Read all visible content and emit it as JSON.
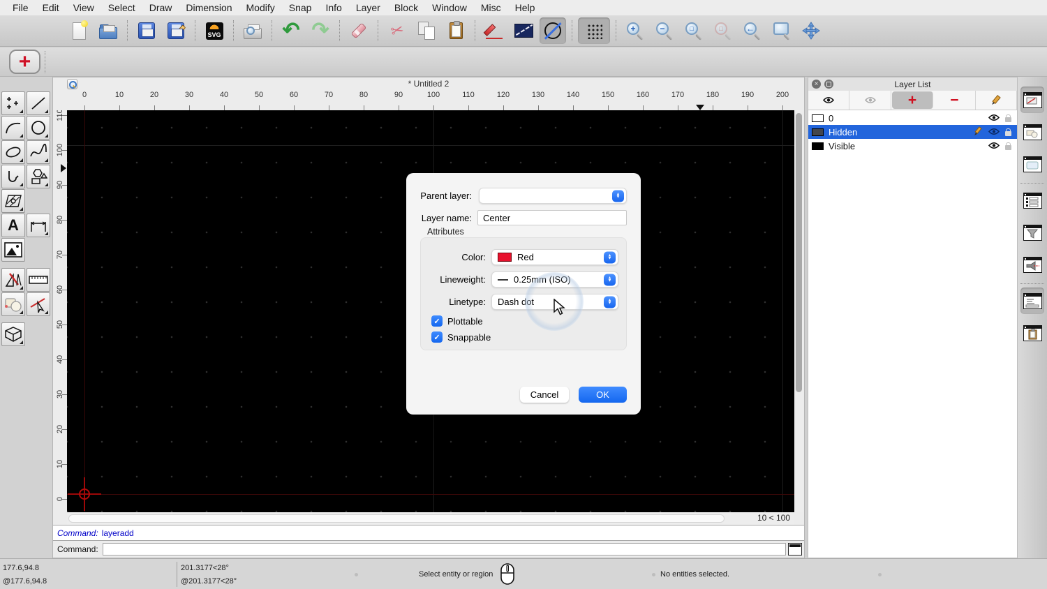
{
  "window": {
    "doc_title": "* Untitled 2"
  },
  "menu": {
    "items": [
      "File",
      "Edit",
      "View",
      "Select",
      "Draw",
      "Dimension",
      "Modify",
      "Snap",
      "Info",
      "Layer",
      "Block",
      "Window",
      "Misc",
      "Help"
    ]
  },
  "icons": {
    "undo-icon": "↶",
    "redo-icon": "↷",
    "cut-icon": "✂",
    "zoom-in-icon": "+",
    "zoom-out-icon": "−",
    "auto-zoom-icon": "□",
    "zoom-selection-icon": "□",
    "previous-view-icon": "←",
    "svg-label": "SVG",
    "text-tool-glyph": "A",
    "add-glyph": "+",
    "remove-glyph": "−",
    "close-glyph": "×",
    "check-glyph": "✓",
    "snap-plus-glyph": "+"
  },
  "rulers": {
    "h_ticks": [
      "0",
      "10",
      "20",
      "30",
      "40",
      "50",
      "60",
      "70",
      "80",
      "90",
      "100",
      "110",
      "120",
      "130",
      "140",
      "150",
      "160",
      "170",
      "180",
      "190",
      "200"
    ],
    "v_ticks": [
      "0",
      "10",
      "20",
      "30",
      "40",
      "50",
      "60",
      "70",
      "80",
      "90",
      "100",
      "110"
    ]
  },
  "canvas": {
    "grid_status": "10 < 100"
  },
  "dialog": {
    "parent_layer_label": "Parent layer:",
    "parent_layer_value": "",
    "layer_name_label": "Layer name:",
    "layer_name_value": "Center",
    "attributes_label": "Attributes",
    "color_label": "Color:",
    "color_value": "Red",
    "lineweight_label": "Lineweight:",
    "lineweight_value": "0.25mm (ISO)",
    "linetype_label": "Linetype:",
    "linetype_value": "Dash dot",
    "plottable_label": "Plottable",
    "snappable_label": "Snappable",
    "cancel_label": "Cancel",
    "ok_label": "OK"
  },
  "layer_list": {
    "title": "Layer List",
    "layers": [
      {
        "name": "0",
        "swatch": "#FFFFFF",
        "selected": false,
        "editing": false
      },
      {
        "name": "Hidden",
        "swatch": "#43464D",
        "selected": true,
        "editing": true
      },
      {
        "name": "Visible",
        "swatch": "#000000",
        "selected": false,
        "editing": false
      }
    ]
  },
  "command": {
    "history_label": "Command:",
    "history_value": "layeradd",
    "prompt_label": "Command:",
    "input_value": ""
  },
  "status_bar": {
    "abs_cartesian": "177.6,94.8",
    "rel_cartesian": "@177.6,94.8",
    "abs_polar": "201.3177<28°",
    "rel_polar": "@201.3177<28°",
    "hint": "Select entity or region",
    "selection_status": "No entities selected."
  },
  "colors": {
    "accent_blue": "#1467EF",
    "selection_blue": "#2265DC",
    "canvas_black": "#000000",
    "layer_red": "#E8112D",
    "command_blue": "#0000C8"
  }
}
